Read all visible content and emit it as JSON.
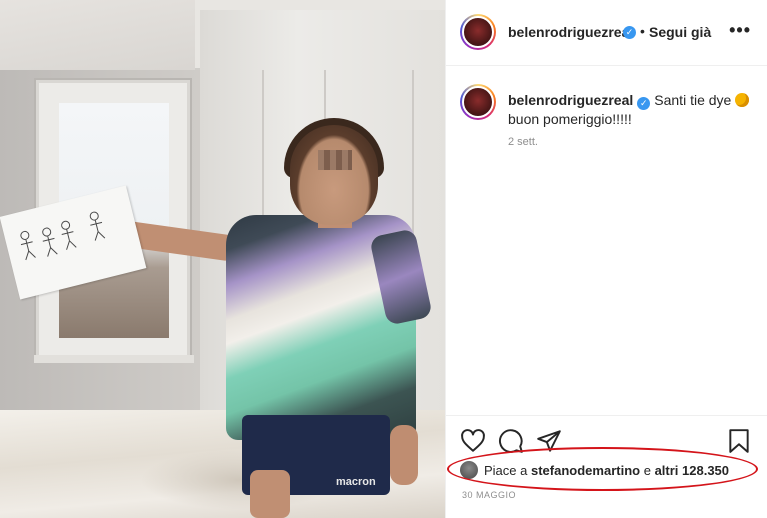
{
  "header": {
    "username": "belenrodriguezreal",
    "separator": "•",
    "follow_label": "Segui già",
    "more_label": "•••"
  },
  "caption": {
    "username": "belenrodriguezreal",
    "text": "Santi tie dye",
    "text_line2": "buon pomeriggio!!!!!",
    "emoji_name": "palette-emoji",
    "time_ago": "2 sett."
  },
  "photo": {
    "shirt_brand": "macron"
  },
  "actions": {
    "like_icon": "heart-icon",
    "comment_icon": "comment-icon",
    "share_icon": "share-icon",
    "save_icon": "bookmark-icon"
  },
  "likes": {
    "prefix": "Piace a",
    "user": "stefanodemartino",
    "conjunction": "e",
    "others": "altri 128.350"
  },
  "post_date": "30 MAGGIO",
  "colors": {
    "annotation": "#d4141a",
    "verified": "#3897f0",
    "text": "#262626",
    "muted": "#8e8e8e"
  }
}
